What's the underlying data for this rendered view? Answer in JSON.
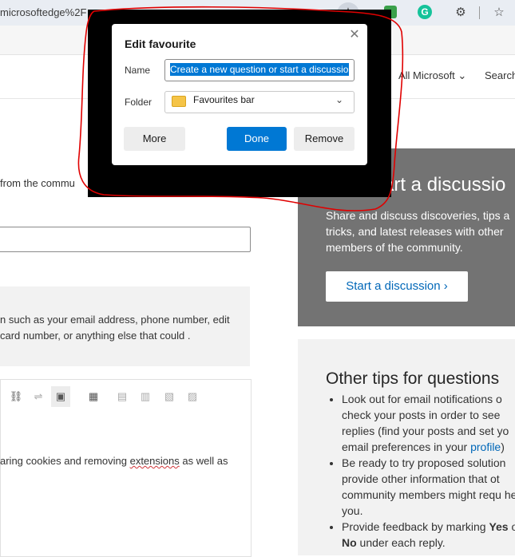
{
  "browser": {
    "url_text": "microsoftedge%2F"
  },
  "site": {
    "all_microsoft": "All Microsoft",
    "search": "Search"
  },
  "left": {
    "from_text": "from the commu",
    "notice_text": "n such as your email address, phone number, edit card number, or anything else that could .",
    "body_before": "aring cookies and removing ",
    "body_link": "extensions",
    "body_after": " as well as"
  },
  "right": {
    "discussion_title": "art a discussio",
    "discussion_desc": "Share and discuss discoveries, tips a tricks, and latest releases with other members of the community.",
    "discussion_button": "Start a discussion ›",
    "tips_title": "Other tips for questions",
    "tips": [
      "Look out for email notifications o check your posts in order to see replies (find your posts and set yo email preferences in your ",
      "Be ready to try proposed solution provide other information that ot community members might requ help you.",
      "Provide feedback by marking "
    ],
    "tip_link": "profile",
    "tip_link_after": ")",
    "tip_bold_yes": "Yes",
    "tip_bold_no": "No",
    "tip_tail": " under each reply."
  },
  "dialog": {
    "title": "Edit favourite",
    "name_label": "Name",
    "name_value": "Create a new question or start a discussion",
    "folder_label": "Folder",
    "folder_value": "Favourites bar",
    "more": "More",
    "done": "Done",
    "remove": "Remove"
  },
  "icons": [
    "star-icon",
    "extension-icon",
    "grammarly-icon",
    "puzzle-icon",
    "favourites-icon",
    "close-icon",
    "chevron-down-icon",
    "folder-icon"
  ],
  "colors": {
    "accent": "#0078d4",
    "link": "#0067b8",
    "card_dark": "#737373",
    "annotation": "#e00000"
  }
}
